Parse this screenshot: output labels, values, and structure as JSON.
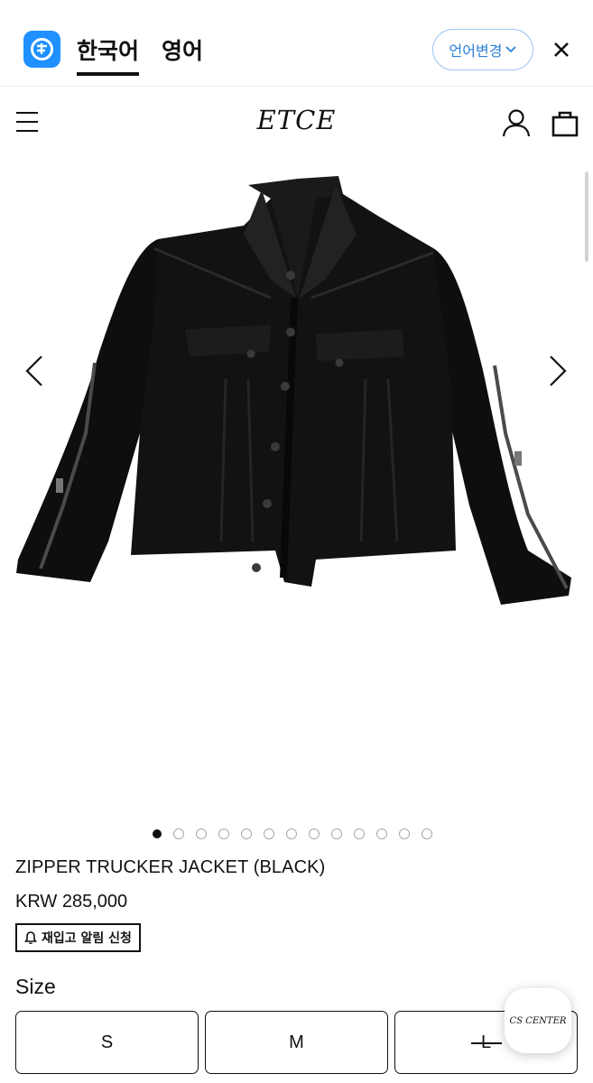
{
  "translate_bar": {
    "tab_korean": "한국어",
    "tab_english": "영어",
    "language_button": "언어변경",
    "accent_color": "#1e90ff"
  },
  "header": {
    "brand": "ETCE",
    "icons": [
      "menu-icon",
      "user-icon",
      "bag-icon"
    ]
  },
  "gallery": {
    "slide_count": 13,
    "active_index": 0,
    "prev_icon": "chevron-left-icon",
    "next_icon": "chevron-right-icon"
  },
  "product": {
    "title": "ZIPPER TRUCKER JACKET (BLACK)",
    "price": "KRW 285,000",
    "restock_label": "재입고 알림 신청"
  },
  "options": {
    "size_label": "Size",
    "sizes": [
      {
        "label": "S",
        "sold_out": false
      },
      {
        "label": "M",
        "sold_out": false
      },
      {
        "label": "L",
        "sold_out": true
      }
    ]
  },
  "floating": {
    "cs_label": "CS CENTER"
  }
}
